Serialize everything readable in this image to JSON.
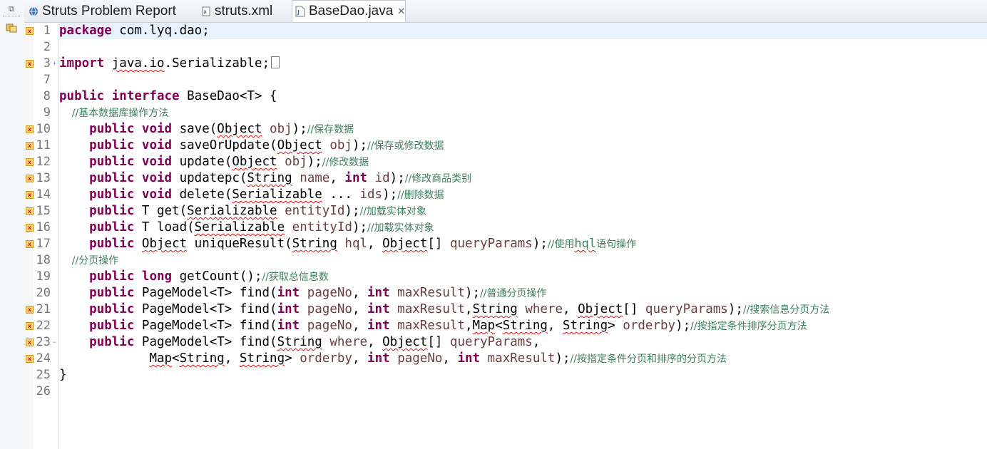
{
  "tabs": [
    {
      "label": "Struts Problem Report",
      "icon": "globe-icon",
      "active": false
    },
    {
      "label": "struts.xml",
      "icon": "xml-file-icon",
      "active": false
    },
    {
      "label": "BaseDao.java",
      "icon": "java-file-icon",
      "active": true
    }
  ],
  "tab_close_glyph": "✕",
  "strip": {
    "restore_icon": "restore-icon",
    "outline_icon": "package-explorer-icon"
  },
  "lines": [
    {
      "num": "1",
      "marker": true,
      "t1": "package",
      "t2": " com.lyq.dao;"
    },
    {
      "num": "2"
    },
    {
      "num": "3",
      "marker": true,
      "fold": "+",
      "t1": "import",
      "t2": " ",
      "t3": "java.io",
      "t4": ".Serializable;"
    },
    {
      "num": "7"
    },
    {
      "num": "8",
      "t1": "public interface",
      "t2": " BaseDao<T> {"
    },
    {
      "num": "9",
      "comment": "    //基本数据库操作方法"
    },
    {
      "num": "10",
      "marker": true,
      "t1": "public void",
      "t2": " save(",
      "t3": "Object",
      "t4": " ",
      "t5": "obj",
      "t6": ");",
      "comment": "//保存数据"
    },
    {
      "num": "11",
      "marker": true,
      "t1": "public void",
      "t2": " saveOrUpdate(",
      "t3": "Object",
      "t4": " ",
      "t5": "obj",
      "t6": ");",
      "comment": "//保存或修改数据"
    },
    {
      "num": "12",
      "marker": true,
      "t1": "public void",
      "t2": " update(",
      "t3": "Object",
      "t4": " ",
      "t5": "obj",
      "t6": ");",
      "comment": "//修改数据"
    },
    {
      "num": "13",
      "marker": true,
      "t1": "public void",
      "t2": " updatepc(",
      "t3": "String",
      "t4": " ",
      "t5": "name",
      "t6": ", ",
      "t7": "int",
      "t8": " ",
      "t9": "id",
      "t10": ");",
      "comment": "//修改商品类别"
    },
    {
      "num": "14",
      "marker": true,
      "t1": "public void",
      "t2": " delete(",
      "t3": "Serializable",
      "t4": " ... ",
      "t5": "ids",
      "t6": ");",
      "comment": "//删除数据"
    },
    {
      "num": "15",
      "marker": true,
      "t1": "public",
      "t2": " T get(",
      "t3": "Serializable",
      "t4": " ",
      "t5": "entityId",
      "t6": ");",
      "comment": "//加载实体对象"
    },
    {
      "num": "16",
      "marker": true,
      "t1": "public",
      "t2": " T load(",
      "t3": "Serializable",
      "t4": " ",
      "t5": "entityId",
      "t6": ");",
      "comment": "//加载实体对象"
    },
    {
      "num": "17",
      "marker": true,
      "t1": "public",
      "t2": " ",
      "t3": "Object",
      "t4": " uniqueResult(",
      "t5": "String",
      "t6": " ",
      "t7": "hql",
      "t8": ", ",
      "t9": "Object",
      "t10": "[] ",
      "t11": "queryParams",
      "t12": ");",
      "comment": "//使用",
      "comment_mono": "hql",
      "comment2": "语句操作"
    },
    {
      "num": "18",
      "comment": "    //分页操作"
    },
    {
      "num": "19",
      "t1": "public long",
      "t2": " getCount();",
      "comment": "//获取总信息数"
    },
    {
      "num": "20",
      "t1": "public",
      "t2": " PageModel<T> find(",
      "t3": "int",
      "t4": " ",
      "t5": "pageNo",
      "t6": ", ",
      "t7": "int",
      "t8": " ",
      "t9": "maxResult",
      "t10": ");",
      "comment": "//普通分页操作"
    },
    {
      "num": "21",
      "marker": true,
      "t1": "public",
      "t2": " PageModel<T> find(",
      "t3": "int",
      "t4": " ",
      "t5": "pageNo",
      "t6": ", ",
      "t7": "int",
      "t8": " ",
      "t9": "maxResult",
      "t10": ",",
      "t11": "String",
      "t12": " ",
      "t13": "where",
      "t14": ", ",
      "t15": "Object",
      "t16": "[] ",
      "t17": "queryParams",
      "t18": ");",
      "comment": "//搜索信息分页方法"
    },
    {
      "num": "22",
      "marker": true,
      "t1": "public",
      "t2": " PageModel<T> find(",
      "t3": "int",
      "t4": " ",
      "t5": "pageNo",
      "t6": ", ",
      "t7": "int",
      "t8": " ",
      "t9": "maxResult",
      "t10": ",",
      "t11": "Map",
      "t12": "<",
      "t13": "String",
      "t14": ", ",
      "t15": "String",
      "t16": "> ",
      "t17": "orderby",
      "t18": ");",
      "comment": "//按指定条件排序分页方法"
    },
    {
      "num": "23",
      "marker": true,
      "fold": "−",
      "t1": "public",
      "t2": " PageModel<T> find(",
      "t3": "String",
      "t4": " ",
      "t5": "where",
      "t6": ", ",
      "t7": "Object",
      "t8": "[] ",
      "t9": "queryParams",
      "t10": ","
    },
    {
      "num": "24",
      "marker": true,
      "t1": "Map",
      "t2": "<",
      "t3": "String",
      "t4": ", ",
      "t5": "String",
      "t6": "> ",
      "t7": "orderby",
      "t8": ", ",
      "t9": "int",
      "t10": " ",
      "t11": "pageNo",
      "t12": ", ",
      "t13": "int",
      "t14": " ",
      "t15": "maxResult",
      "t16": ");",
      "comment": "//按指定条件分页和排序的分页方法"
    },
    {
      "num": "25",
      "t1": "}"
    },
    {
      "num": "26"
    }
  ]
}
